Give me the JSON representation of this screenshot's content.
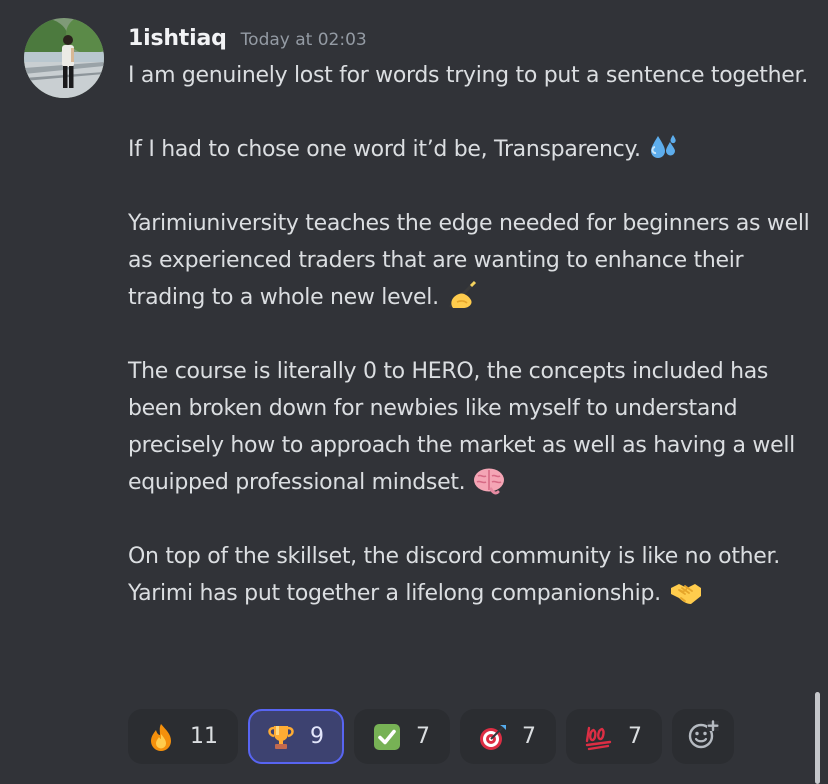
{
  "message": {
    "author": "1ishtiaq",
    "timestamp": "Today at 02:03",
    "avatar": "avatar-photo",
    "paragraphs": [
      {
        "text": "I am genuinely lost for words trying to put a sentence together.",
        "emoji": null
      },
      {
        "text": "If I had to chose one word it’d be, Transparency.",
        "emoji": "sweat-droplets-icon"
      },
      {
        "text": "Yarimiuniversity teaches the edge needed for beginners as well as experienced traders that are wanting to enhance their trading to a whole new level.",
        "emoji": "writing-hand-icon"
      },
      {
        "text": "The course is literally 0 to HERO, the concepts included has been broken down for newbies like myself to understand precisely how to approach the market as well as having a well equipped professional mindset.",
        "emoji": "brain-icon"
      },
      {
        "text": "On top of the skillset, the discord community is like no other. Yarimi has put together a lifelong companionship.",
        "emoji": "handshake-icon"
      }
    ]
  },
  "reactions": [
    {
      "icon": "fire-icon",
      "count": "11",
      "active": false
    },
    {
      "icon": "trophy-icon",
      "count": "9",
      "active": true
    },
    {
      "icon": "check-mark-icon",
      "count": "7",
      "active": false
    },
    {
      "icon": "dart-target-icon",
      "count": "7",
      "active": false
    },
    {
      "icon": "hundred-points-icon",
      "count": "7",
      "active": false
    }
  ],
  "add_reaction_icon": "add-reaction-icon",
  "colors": {
    "background": "#313338",
    "reaction_bg": "#2b2d31",
    "reaction_active_bg": "#3d4270",
    "reaction_active_border": "#5865f2",
    "username": "#f2f3f5",
    "timestamp": "#949ba4",
    "text": "#dbdee1"
  }
}
